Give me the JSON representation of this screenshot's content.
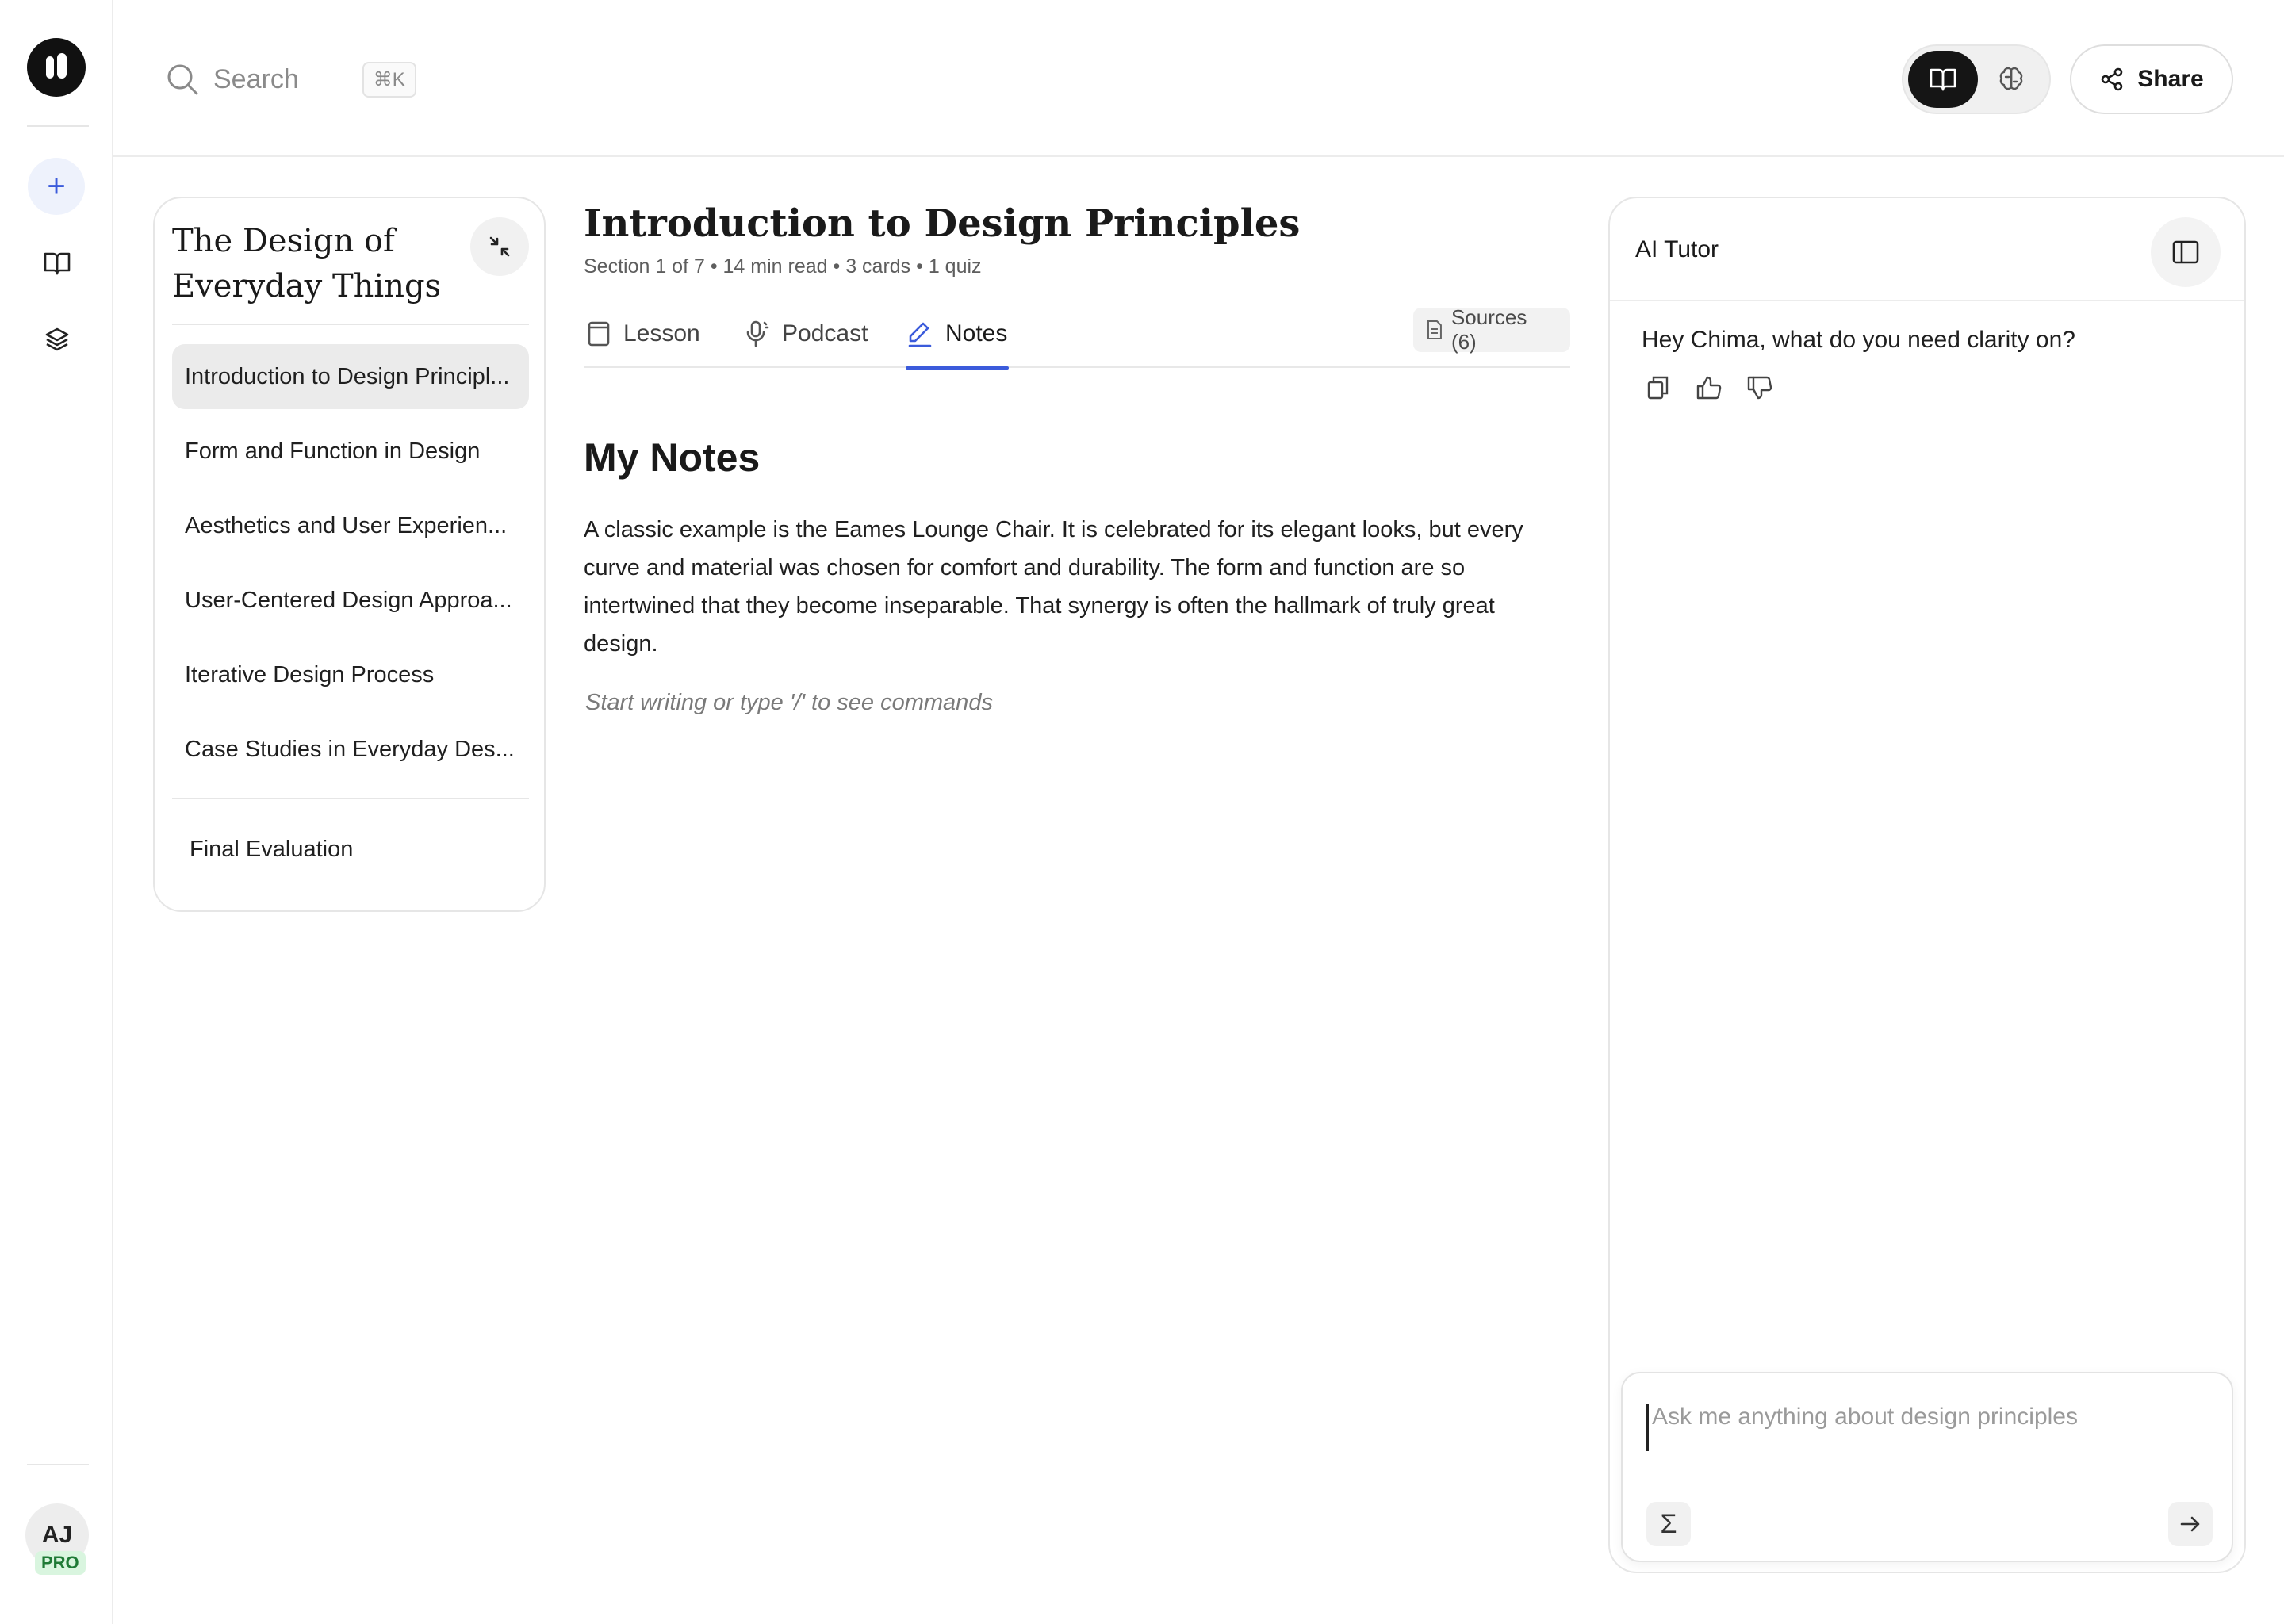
{
  "search": {
    "label": "Search",
    "shortcut": "⌘K"
  },
  "toolbar": {
    "share_label": "Share",
    "mode_options": [
      "read-mode",
      "brain-mode"
    ]
  },
  "user": {
    "initials": "AJ",
    "plan": "PRO"
  },
  "course": {
    "title": "The Design of Everyday Things",
    "sections": [
      {
        "label": "Introduction to Design Principl...",
        "active": true
      },
      {
        "label": "Form and Function in Design",
        "active": false
      },
      {
        "label": "Aesthetics and User Experien...",
        "active": false
      },
      {
        "label": "User-Centered Design Approa...",
        "active": false
      },
      {
        "label": "Iterative Design Process",
        "active": false
      },
      {
        "label": "Case Studies in Everyday Des...",
        "active": false
      }
    ],
    "final": "Final Evaluation"
  },
  "lesson": {
    "title": "Introduction to Design Principles",
    "meta": "Section 1 of 7 • 14 min read • 3 cards • 1 quiz",
    "tabs": [
      {
        "label": "Lesson",
        "icon": "book-icon"
      },
      {
        "label": "Podcast",
        "icon": "microphone-icon"
      },
      {
        "label": "Notes",
        "icon": "pencil-icon",
        "active": true
      }
    ],
    "sources_label": "Sources (6)"
  },
  "notes": {
    "heading": "My Notes",
    "body": "A classic example is the Eames Lounge Chair. It is celebrated for its elegant looks, but every curve and material was chosen for comfort and durability. The form and function are so intertwined that they become inseparable. That synergy is often the hallmark of truly great design.",
    "placeholder": "Start writing or type '/' to see commands"
  },
  "tutor": {
    "title": "AI Tutor",
    "greeting": "Hey Chima, what do you need clarity on?",
    "input_placeholder": "Ask me anything about design principles",
    "input_value": "",
    "sigma": "Σ"
  },
  "colors": {
    "accent": "#3b5bdb",
    "active_item_bg": "#ebebeb",
    "dark": "#151515",
    "pro_bg": "#d9f5df",
    "pro_text": "#1f7a36"
  }
}
